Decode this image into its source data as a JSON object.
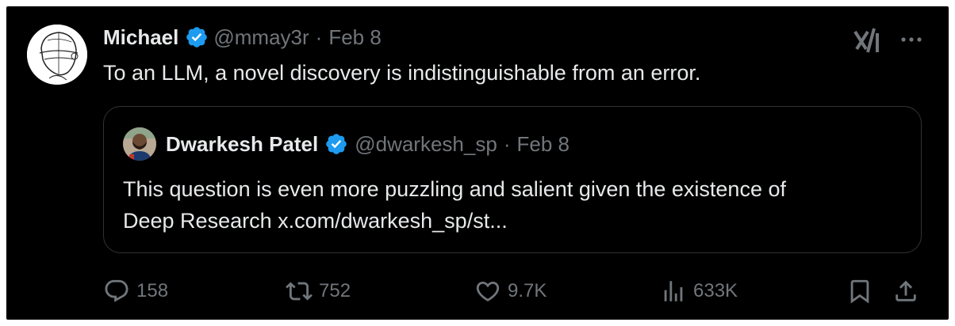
{
  "tweet": {
    "author_name": "Michael",
    "handle": "@mmay3r",
    "separator": "·",
    "date": "Feb 8",
    "text": "To an LLM, a novel discovery is indistinguishable from an error."
  },
  "quote": {
    "author_name": "Dwarkesh Patel",
    "handle": "@dwarkesh_sp",
    "separator": "·",
    "date": "Feb 8",
    "text_line1": "This question is even more puzzling and salient given the existence of",
    "text_line2": "Deep Research x.com/dwarkesh_sp/st..."
  },
  "actions": {
    "replies": "158",
    "reposts": "752",
    "likes": "9.7K",
    "views": "633K"
  },
  "icons": {
    "verified": "verified-badge-icon",
    "grok": "grok-icon",
    "more": "more-icon",
    "reply": "reply-icon",
    "repost": "repost-icon",
    "like": "heart-icon",
    "views": "views-icon",
    "bookmark": "bookmark-icon",
    "share": "share-icon"
  },
  "colors": {
    "background": "#000000",
    "text_primary": "#e7e9ea",
    "text_secondary": "#71767b",
    "verified": "#1d9bf0",
    "border": "#2f3336"
  }
}
